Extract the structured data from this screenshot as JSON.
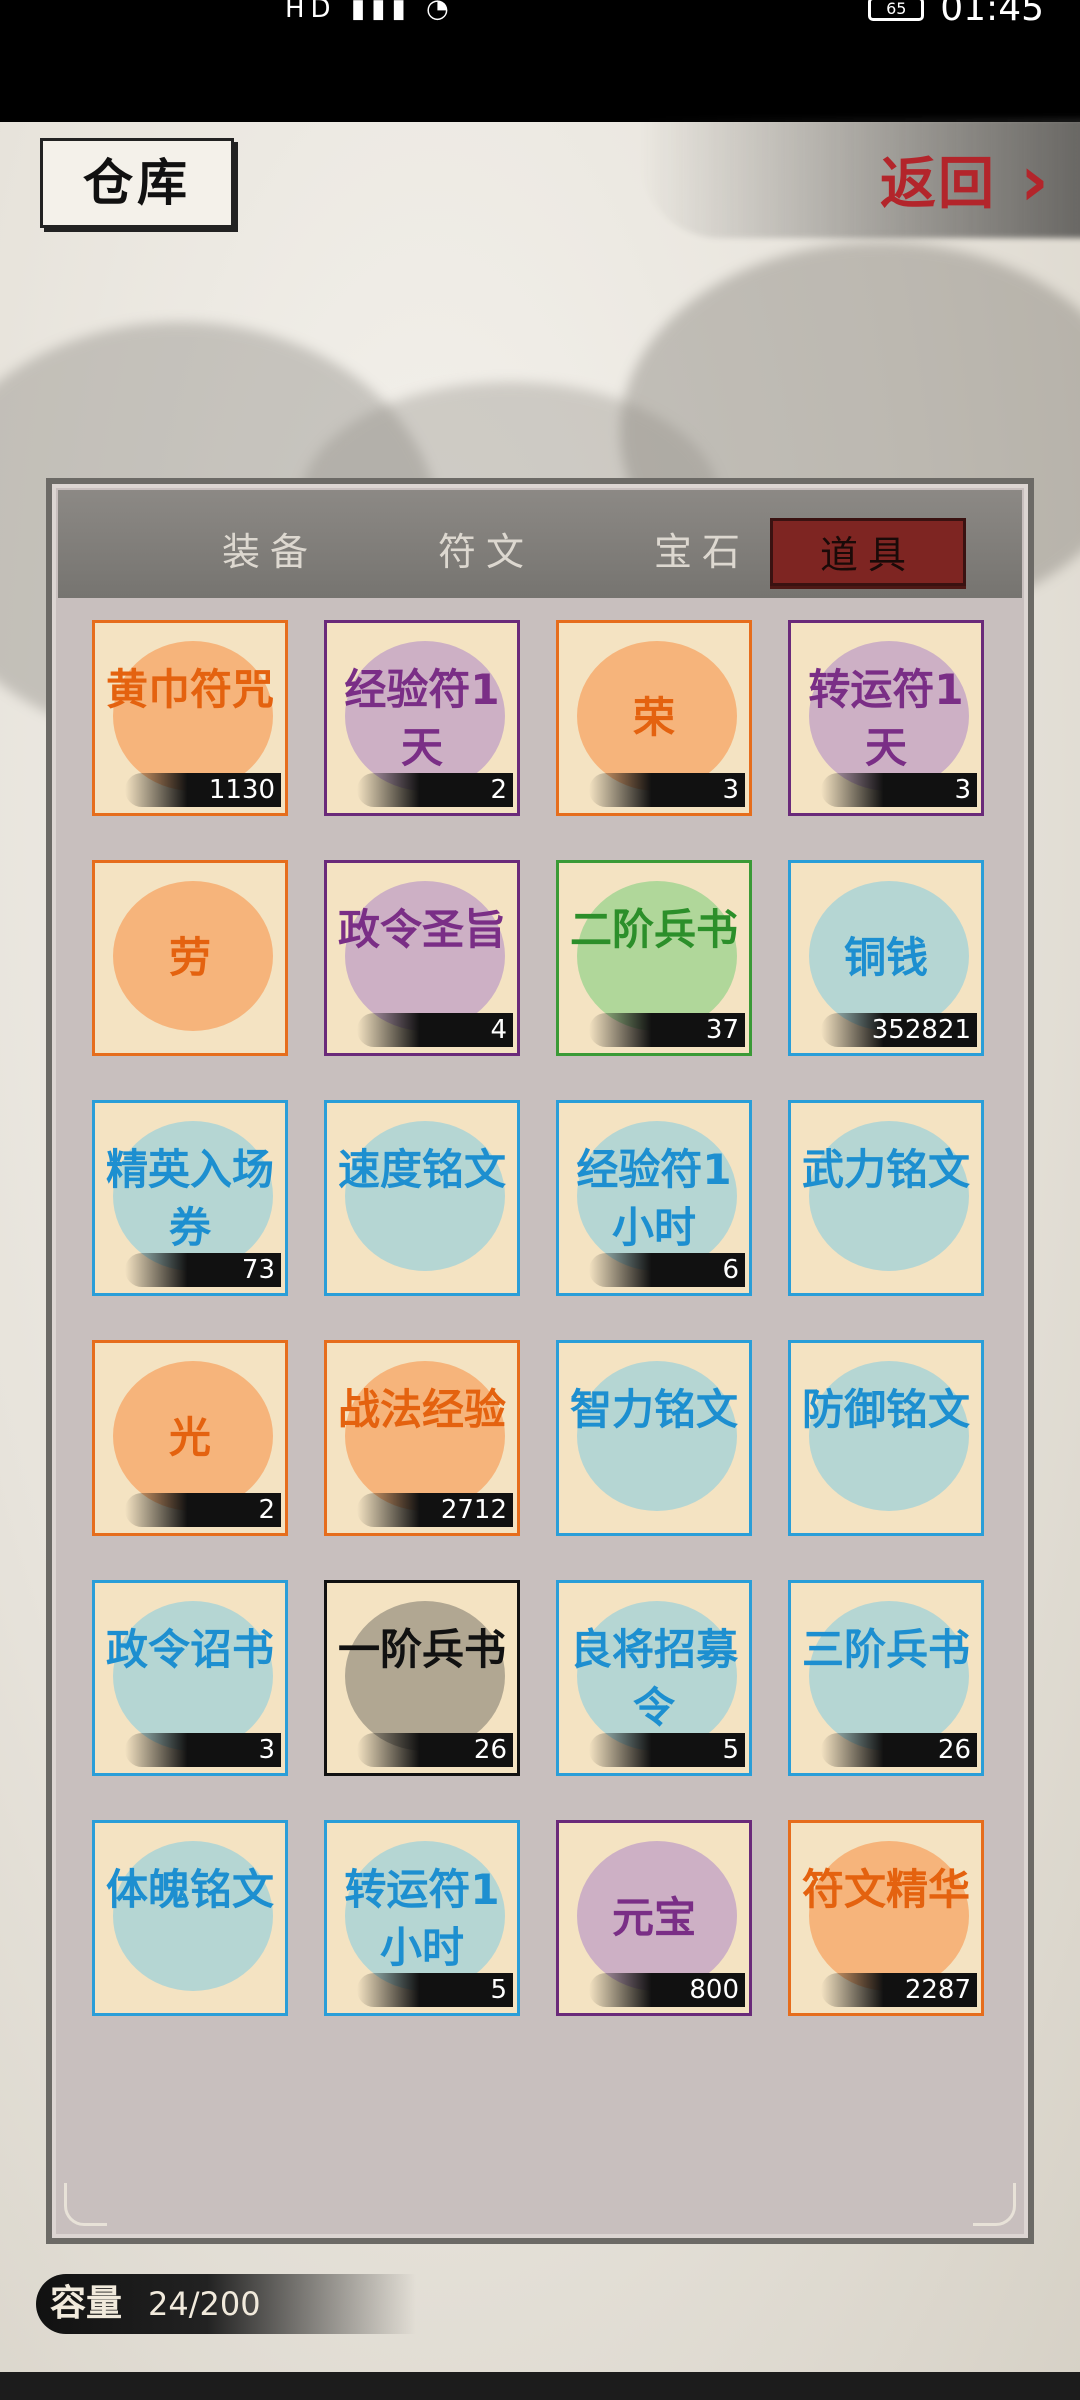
{
  "status_bar": {
    "network": "HD",
    "time": "01:45",
    "battery": "65"
  },
  "header": {
    "title": "仓库",
    "back_label": "返回"
  },
  "tabs": [
    {
      "label": "装备",
      "active": false
    },
    {
      "label": "符文",
      "active": false
    },
    {
      "label": "宝石",
      "active": false
    },
    {
      "label": "道具",
      "active": true
    }
  ],
  "items": [
    {
      "name": "黄巾符咒",
      "count": "1130",
      "rarity": "orange"
    },
    {
      "name": "经验符1天",
      "count": "2",
      "rarity": "purple"
    },
    {
      "name": "荣",
      "count": "3",
      "rarity": "orange"
    },
    {
      "name": "转运符1天",
      "count": "3",
      "rarity": "purple"
    },
    {
      "name": "劳",
      "count": "",
      "rarity": "orange"
    },
    {
      "name": "政令圣旨",
      "count": "4",
      "rarity": "purple"
    },
    {
      "name": "二阶兵书",
      "count": "37",
      "rarity": "green"
    },
    {
      "name": "铜钱",
      "count": "352821",
      "rarity": "blue"
    },
    {
      "name": "精英入场券",
      "count": "73",
      "rarity": "blue"
    },
    {
      "name": "速度铭文",
      "count": "",
      "rarity": "blue"
    },
    {
      "name": "经验符1小时",
      "count": "6",
      "rarity": "blue"
    },
    {
      "name": "武力铭文",
      "count": "",
      "rarity": "blue"
    },
    {
      "name": "光",
      "count": "2",
      "rarity": "orange"
    },
    {
      "name": "战法经验",
      "count": "2712",
      "rarity": "orange"
    },
    {
      "name": "智力铭文",
      "count": "",
      "rarity": "blue"
    },
    {
      "name": "防御铭文",
      "count": "",
      "rarity": "blue"
    },
    {
      "name": "政令诏书",
      "count": "3",
      "rarity": "blue"
    },
    {
      "name": "一阶兵书",
      "count": "26",
      "rarity": "black"
    },
    {
      "name": "良将招募令",
      "count": "5",
      "rarity": "blue"
    },
    {
      "name": "三阶兵书",
      "count": "26",
      "rarity": "blue"
    },
    {
      "name": "体魄铭文",
      "count": "",
      "rarity": "blue"
    },
    {
      "name": "转运符1小时",
      "count": "5",
      "rarity": "blue"
    },
    {
      "name": "元宝",
      "count": "800",
      "rarity": "purple"
    },
    {
      "name": "符文精华",
      "count": "2287",
      "rarity": "orange"
    }
  ],
  "capacity": {
    "label": "容量",
    "value": "24/200"
  }
}
